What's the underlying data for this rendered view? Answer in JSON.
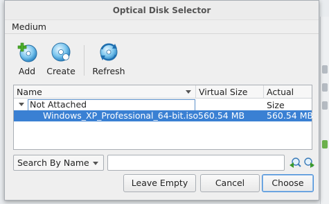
{
  "dialog": {
    "title": "Optical Disk Selector"
  },
  "menubar": {
    "items": [
      "Medium"
    ]
  },
  "toolbar": {
    "add_label": "Add",
    "create_label": "Create",
    "refresh_label": "Refresh",
    "icons": {
      "add": "add-disk-icon",
      "create": "create-disk-icon",
      "refresh": "refresh-icon"
    }
  },
  "tree": {
    "columns": [
      "Name",
      "Virtual Size",
      "Actual Size"
    ],
    "group": "Not Attached",
    "rows": [
      {
        "name": "Windows_XP_Professional_64-bit.iso",
        "virtual_size": "560.54 MB",
        "actual_size": "560.54 MB",
        "selected": true
      }
    ]
  },
  "search": {
    "mode": "Search By Name",
    "value": "",
    "prev_icon": "search-prev-icon",
    "next_icon": "search-next-icon"
  },
  "buttons": {
    "leave_empty": "Leave Empty",
    "cancel": "Cancel",
    "choose": "Choose"
  },
  "colors": {
    "selection": "#3a80d3",
    "accent": "#4a90d9"
  }
}
